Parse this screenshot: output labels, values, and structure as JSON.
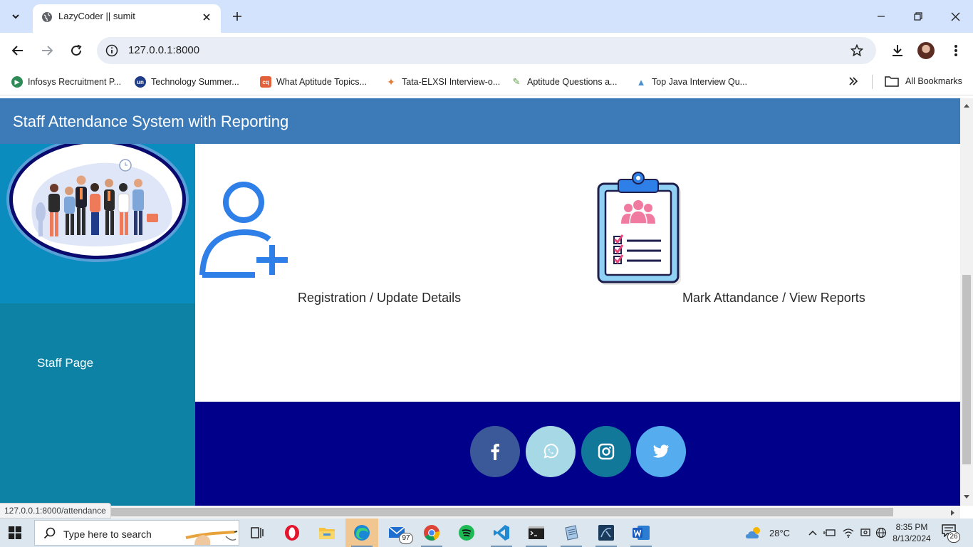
{
  "browser": {
    "tab_title": "LazyCoder || sumit",
    "url": "127.0.0.1:8000",
    "status_url": "127.0.0.1:8000/attendance",
    "bookmarks": [
      {
        "label": "Infosys Recruitment P...",
        "icon": "infosys-icon",
        "color": "#2e8b57"
      },
      {
        "label": "Technology Summer...",
        "icon": "un-icon",
        "color": "#1f3c88"
      },
      {
        "label": "What Aptitude Topics...",
        "icon": "cq-icon",
        "color": "#e2603a"
      },
      {
        "label": "Tata-ELXSI Interview-o...",
        "icon": "tata-icon",
        "color": "#e07b39"
      },
      {
        "label": "Aptitude Questions a...",
        "icon": "pencil-icon",
        "color": "#5a9e3c"
      },
      {
        "label": "Top Java Interview Qu...",
        "icon": "java-icon",
        "color": "#4a8fd0"
      }
    ],
    "all_bookmarks_label": "All Bookmarks"
  },
  "site": {
    "title": "Staff Attendance System with Reporting",
    "sidebar_link": "Staff Page",
    "cards": [
      {
        "label": "Registration / Update Details",
        "icon": "add-user-icon"
      },
      {
        "label": "Mark Attandance / View Reports",
        "icon": "clipboard-attendance-icon"
      }
    ],
    "social": [
      {
        "name": "facebook",
        "color": "#3b5998"
      },
      {
        "name": "whatsapp",
        "color": "#a6d8e6"
      },
      {
        "name": "instagram",
        "color": "#12789a"
      },
      {
        "name": "twitter",
        "color": "#55acee"
      }
    ],
    "colors": {
      "header": "#3d7ab8",
      "sidebar": "#0e82a4",
      "footer": "#00008b"
    }
  },
  "taskbar": {
    "search_placeholder": "Type here to search",
    "mail_badge": "97",
    "weather": "28°C",
    "time": "8:35 PM",
    "date": "8/13/2024",
    "notification_count": "26"
  }
}
